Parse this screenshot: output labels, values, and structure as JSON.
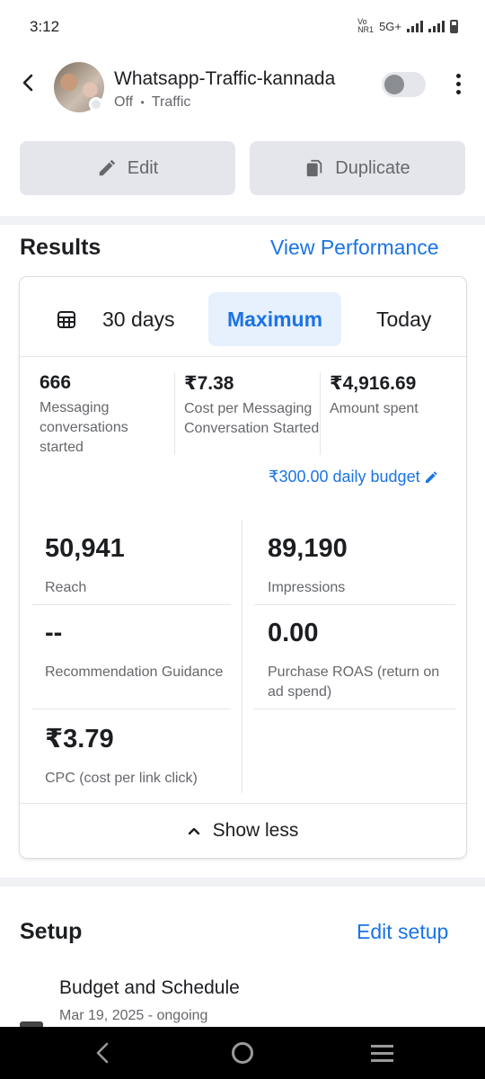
{
  "status_bar": {
    "time": "3:12",
    "network": "5G+",
    "carrier": "Vo NR1"
  },
  "header": {
    "title": "Whatsapp-Traffic-kannada",
    "status": "Off",
    "separator": "•",
    "objective": "Traffic",
    "toggle_on": false
  },
  "actions": {
    "edit_label": "Edit",
    "duplicate_label": "Duplicate"
  },
  "results": {
    "title": "Results",
    "view_link": "View Performance",
    "tabs": [
      {
        "label": "30 days",
        "selected": false
      },
      {
        "label": "Maximum",
        "selected": true
      },
      {
        "label": "Today",
        "selected": false
      }
    ],
    "summary": [
      {
        "value": "666",
        "label": "Messaging conversations started"
      },
      {
        "value": "₹7.38",
        "label": "Cost per Messaging Conversation Started"
      },
      {
        "value": "₹4,916.69",
        "label": "Amount spent"
      }
    ],
    "budget": "₹300.00 daily budget",
    "stats": [
      {
        "value": "50,941",
        "label": "Reach"
      },
      {
        "value": "89,190",
        "label": "Impressions"
      },
      {
        "value": "--",
        "label": "Recommendation Guidance"
      },
      {
        "value": "0.00",
        "label": "Purchase ROAS (return on ad spend)"
      },
      {
        "value": "₹3.79",
        "label": "CPC (cost per link click)"
      }
    ],
    "show_less": "Show less"
  },
  "setup": {
    "title": "Setup",
    "edit_link": "Edit setup",
    "row_title": "Budget and Schedule",
    "row_sub": "Mar 19, 2025 - ongoing"
  },
  "colors": {
    "accent": "#1b74e4",
    "muted": "#65676b",
    "button_bg": "#e4e6eb"
  }
}
